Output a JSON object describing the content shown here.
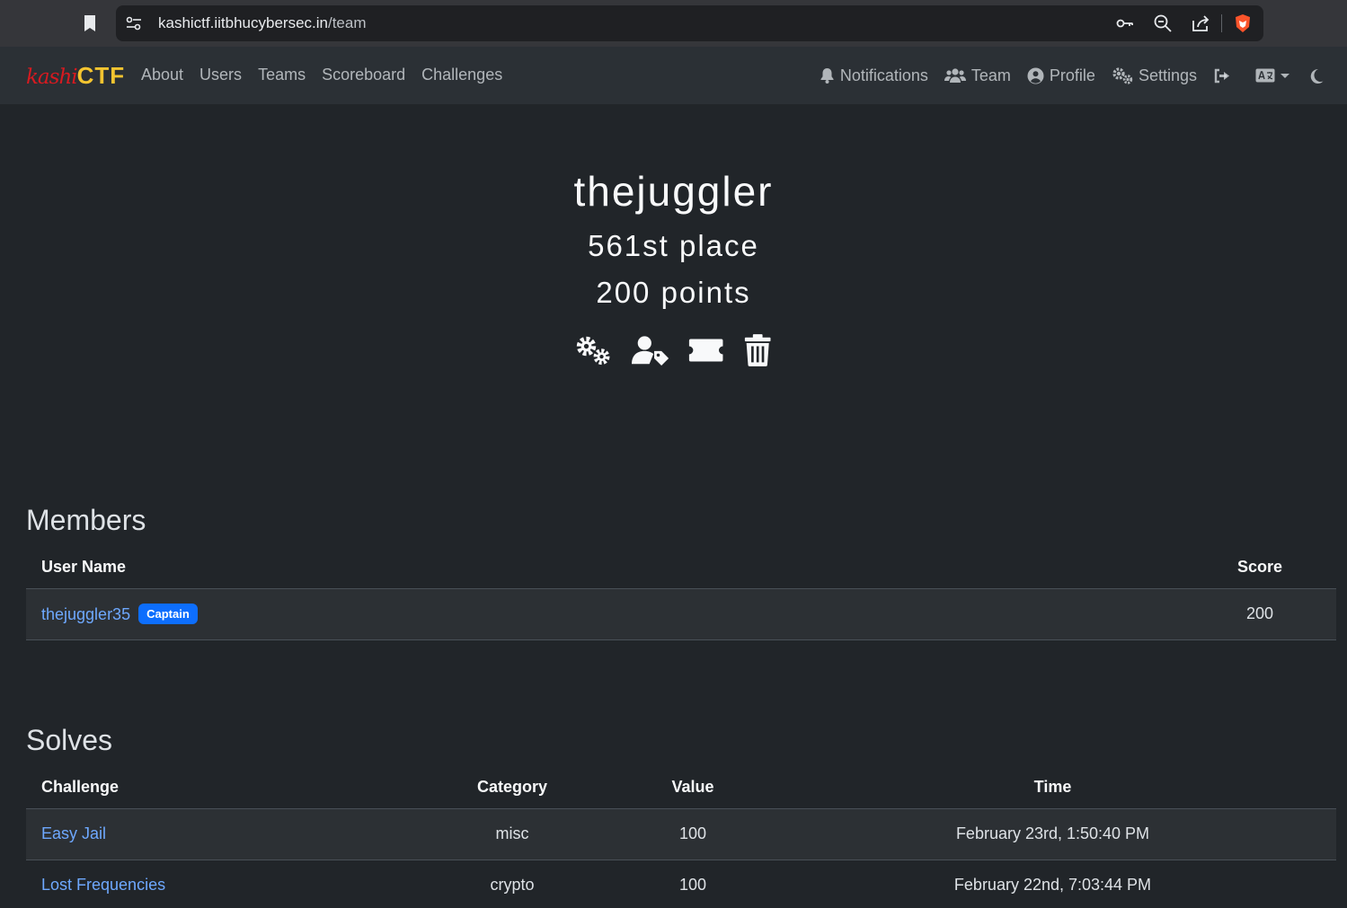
{
  "browser": {
    "url_host": "kashictf.iitbhucybersec.in",
    "url_path": "/team"
  },
  "navbar": {
    "brand_left": "kashi",
    "brand_right": "CTF",
    "left_links": [
      "About",
      "Users",
      "Teams",
      "Scoreboard",
      "Challenges"
    ],
    "right_items": {
      "notifications": "Notifications",
      "team": "Team",
      "profile": "Profile",
      "settings": "Settings"
    }
  },
  "team": {
    "name": "thejuggler",
    "place": "561st place",
    "points": "200 points"
  },
  "members": {
    "title": "Members",
    "headers": [
      "User Name",
      "Score"
    ],
    "rows": [
      {
        "name": "thejuggler35",
        "badge": "Captain",
        "score": "200"
      }
    ]
  },
  "solves": {
    "title": "Solves",
    "headers": [
      "Challenge",
      "Category",
      "Value",
      "Time"
    ],
    "rows": [
      {
        "challenge": "Easy Jail",
        "category": "misc",
        "value": "100",
        "time": "February 23rd, 1:50:40 PM"
      },
      {
        "challenge": "Lost Frequencies",
        "category": "crypto",
        "value": "100",
        "time": "February 22nd, 7:03:44 PM"
      }
    ]
  },
  "colors": {
    "background": "#212529",
    "navbar": "#2b3035",
    "link": "#6ea8fe",
    "badge": "#0d6efd",
    "brand_kashi": "#d71a20",
    "brand_ctf": "#f4c430"
  }
}
